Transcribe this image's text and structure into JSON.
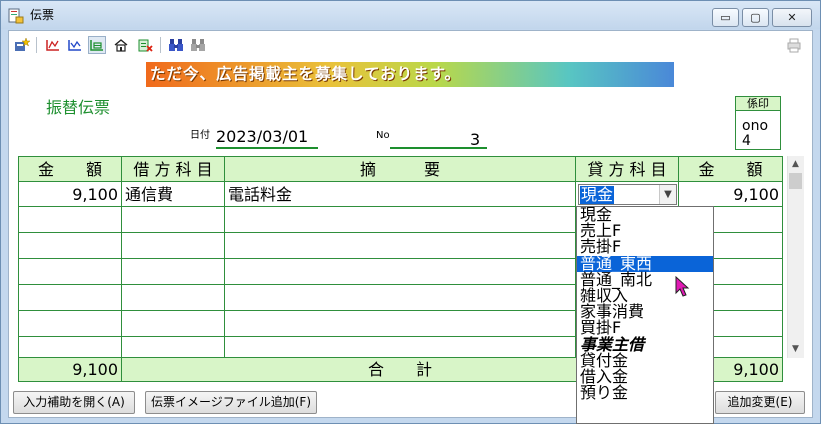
{
  "window": {
    "title": "伝票",
    "controls": {
      "minimize": "▭",
      "maximize": "▢",
      "close": "✕"
    }
  },
  "toolbar": {
    "icons": [
      "new-slip-icon",
      "debit-red-icon",
      "credit-blue-icon",
      "ledger-green-icon",
      "house-icon",
      "delete-slip-icon",
      "search-binoculars-icon",
      "search-binoculars-grey-icon",
      "printer-disabled-icon"
    ]
  },
  "banner": {
    "text": "ただ今、広告掲載主を募集しております。"
  },
  "form": {
    "title": "振替伝票",
    "date_label": "日付",
    "date_value": "2023/03/01",
    "no_label": "No",
    "no_value": "3",
    "stamp_header": "係印",
    "stamp_name": "ono",
    "stamp_number": "4"
  },
  "table": {
    "headers": {
      "debit_amount": "金　　額",
      "debit_account": "借 方 科 目",
      "description": "摘　　　要",
      "credit_account": "貸 方 科 目",
      "credit_amount": "金　　額"
    },
    "row1": {
      "debit_amount": "9,100",
      "debit_account": "通信費",
      "description": "電話料金",
      "credit_account": "現金",
      "credit_amount": "9,100"
    },
    "totals": {
      "debit_total": "9,100",
      "label": "合　　計",
      "credit_total": "9,100"
    }
  },
  "dropdown": {
    "options": [
      "現金",
      "売上F",
      "売掛F",
      "普通_東西",
      "普通_南北",
      "雑収入",
      "家事消費",
      "買掛F",
      "事業主借",
      "貸付金",
      "借入金",
      "預り金"
    ],
    "selected_index": 3,
    "bold_index": 8
  },
  "buttons": {
    "open_assist": "入力補助を開く(A)",
    "add_image_file": "伝票イメージファイル追加(F)",
    "add_change": "追加変更(E)"
  }
}
